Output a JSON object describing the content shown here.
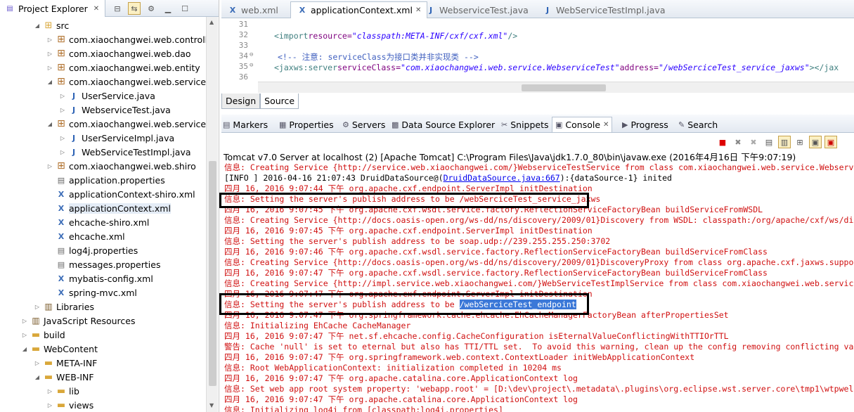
{
  "explorer": {
    "title": "Project Explorer",
    "items": [
      {
        "label": "src",
        "kind": "folder-src",
        "twisty": "open"
      },
      {
        "label": "com.xiaochangwei.web.controller",
        "kind": "pkg",
        "twisty": "closed"
      },
      {
        "label": "com.xiaochangwei.web.dao",
        "kind": "pkg",
        "twisty": "closed"
      },
      {
        "label": "com.xiaochangwei.web.entity",
        "kind": "pkg",
        "twisty": "closed"
      },
      {
        "label": "com.xiaochangwei.web.service",
        "kind": "pkg",
        "twisty": "open"
      },
      {
        "label": "UserService.java",
        "kind": "java",
        "twisty": "closed"
      },
      {
        "label": "WebserviceTest.java",
        "kind": "java",
        "twisty": "closed"
      },
      {
        "label": "com.xiaochangwei.web.service.im",
        "kind": "pkg",
        "twisty": "open"
      },
      {
        "label": "UserServiceImpl.java",
        "kind": "java",
        "twisty": "closed"
      },
      {
        "label": "WebServiceTestImpl.java",
        "kind": "java",
        "twisty": "closed"
      },
      {
        "label": "com.xiaochangwei.web.shiro",
        "kind": "pkg",
        "twisty": "closed"
      },
      {
        "label": "application.properties",
        "kind": "prop",
        "twisty": ""
      },
      {
        "label": "applicationContext-shiro.xml",
        "kind": "xml",
        "twisty": ""
      },
      {
        "label": "applicationContext.xml",
        "kind": "xml",
        "twisty": "",
        "selected": true
      },
      {
        "label": "ehcache-shiro.xml",
        "kind": "xml",
        "twisty": ""
      },
      {
        "label": "ehcache.xml",
        "kind": "xml",
        "twisty": ""
      },
      {
        "label": "log4j.properties",
        "kind": "prop",
        "twisty": ""
      },
      {
        "label": "messages.properties",
        "kind": "prop",
        "twisty": ""
      },
      {
        "label": "mybatis-config.xml",
        "kind": "xml",
        "twisty": ""
      },
      {
        "label": "spring-mvc.xml",
        "kind": "xml",
        "twisty": ""
      },
      {
        "label": "Libraries",
        "kind": "lib",
        "twisty": "closed"
      },
      {
        "label": "JavaScript Resources",
        "kind": "lib",
        "twisty": "closed"
      },
      {
        "label": "build",
        "kind": "folder",
        "twisty": "closed"
      },
      {
        "label": "WebContent",
        "kind": "folder",
        "twisty": "open"
      },
      {
        "label": "META-INF",
        "kind": "folder",
        "twisty": "closed"
      },
      {
        "label": "WEB-INF",
        "kind": "folder",
        "twisty": "open"
      },
      {
        "label": "lib",
        "kind": "folder",
        "twisty": "closed"
      },
      {
        "label": "views",
        "kind": "folder",
        "twisty": "closed"
      }
    ]
  },
  "editor": {
    "tabs": [
      {
        "label": "web.xml",
        "active": false
      },
      {
        "label": "applicationContext.xml",
        "active": true
      },
      {
        "label": "WebserviceTest.java",
        "active": false
      },
      {
        "label": "WebServiceTestImpl.java",
        "active": false
      }
    ],
    "lines": [
      {
        "num": "31",
        "parts": []
      },
      {
        "num": "32",
        "parts": [
          [
            "tg",
            "<import "
          ],
          [
            "at",
            "resource="
          ],
          [
            "av",
            "\"classpath:META-INF/cxf/cxf.xml\""
          ],
          [
            "tg",
            " />"
          ]
        ]
      },
      {
        "num": "33",
        "parts": []
      },
      {
        "num": "34",
        "marker": "⊖",
        "parts": [
          [
            "cm",
            "<!-- 注意: serviceClass为接口类并非实现类 -->"
          ]
        ]
      },
      {
        "num": "35",
        "marker": "⊖",
        "parts": [
          [
            "tg",
            "<jaxws:server "
          ],
          [
            "at",
            "serviceClass="
          ],
          [
            "av",
            "\"com.xiaochangwei.web.service.WebserviceTest\""
          ],
          [
            "at",
            " address="
          ],
          [
            "av",
            "\"/webSerciceTest_service_jaxws\""
          ],
          [
            "tg",
            "></jax"
          ]
        ]
      },
      {
        "num": "36",
        "parts": []
      }
    ],
    "design_tab": "Design",
    "source_tab": "Source"
  },
  "console": {
    "tabs": [
      {
        "label": "Markers",
        "icon": "▤"
      },
      {
        "label": "Properties",
        "icon": "▦"
      },
      {
        "label": "Servers",
        "icon": "⚙"
      },
      {
        "label": "Data Source Explorer",
        "icon": "▩"
      },
      {
        "label": "Snippets",
        "icon": "✂"
      },
      {
        "label": "Console",
        "icon": "▣",
        "active": true
      },
      {
        "label": "Progress",
        "icon": "▶"
      },
      {
        "label": "Search",
        "icon": "✎"
      }
    ],
    "title": "Tomcat v7.0 Server at localhost (2) [Apache Tomcat] C:\\Program Files\\Java\\jdk1.7.0_80\\bin\\javaw.exe (2016年4月16日 下午9:07:19)",
    "lines": [
      {
        "t": "信息: Creating Service {http://service.web.xiaochangwei.com/}WebserviceTestService from class com.xiaochangwei.web.service.Webserv"
      },
      {
        "t": "[INFO ] 2016-04-16 21:07:43 DruidDataSource@(",
        "link": "DruidDataSource.java:667",
        "after": "):{dataSource-1} inited",
        "info": true
      },
      {
        "t": "四月 16, 2016 9:07:44 下午 org.apache.cxf.endpoint.ServerImpl initDestination"
      },
      {
        "t": "信息: Setting the server's publish address to be /webSerciceTest_service_jaxws"
      },
      {
        "t": "四月 16, 2016 9:07:45 下午 org.apache.cxf.wsdl.service.factory.ReflectionServiceFactoryBean buildServiceFromWSDL"
      },
      {
        "t": "信息: Creating Service {http://docs.oasis-open.org/ws-dd/ns/discovery/2009/01}Discovery from WSDL: classpath:/org/apache/cxf/ws/di"
      },
      {
        "t": "四月 16, 2016 9:07:45 下午 org.apache.cxf.endpoint.ServerImpl initDestination"
      },
      {
        "t": "信息: Setting the server's publish address to be soap.udp://239.255.255.250:3702"
      },
      {
        "t": "四月 16, 2016 9:07:46 下午 org.apache.cxf.wsdl.service.factory.ReflectionServiceFactoryBean buildServiceFromClass"
      },
      {
        "t": "信息: Creating Service {http://docs.oasis-open.org/ws-dd/ns/discovery/2009/01}DiscoveryProxy from class org.apache.cxf.jaxws.suppo"
      },
      {
        "t": "四月 16, 2016 9:07:47 下午 org.apache.cxf.wsdl.service.factory.ReflectionServiceFactoryBean buildServiceFromClass"
      },
      {
        "t": "信息: Creating Service {http://impl.service.web.xiaochangwei.com/}WebServiceTestImplService from class com.xiaochangwei.web.servic"
      },
      {
        "t": "四月 16, 2016 9:07:47 下午 org.apache.cxf.endpoint.ServerImpl initDestination"
      },
      {
        "t": "信息: Setting the server's publish address to be ",
        "hl": "/webSerciceTest_endpoint"
      },
      {
        "t": "四月 16, 2016 9:07:47 下午 org.springframework.cache.ehcache.EhCacheManagerFactoryBean afterPropertiesSet"
      },
      {
        "t": "信息: Initializing EhCache CacheManager"
      },
      {
        "t": "四月 16, 2016 9:07:47 下午 net.sf.ehcache.config.CacheConfiguration isEternalValueConflictingWithTTIOrTTL"
      },
      {
        "t": "警告: Cache 'null' is set to eternal but also has TTI/TTL set.  To avoid this warning, clean up the config removing conflicting va"
      },
      {
        "t": "四月 16, 2016 9:07:47 下午 org.springframework.web.context.ContextLoader initWebApplicationContext"
      },
      {
        "t": "信息: Root WebApplicationContext: initialization completed in 10204 ms"
      },
      {
        "t": "四月 16, 2016 9:07:47 下午 org.apache.catalina.core.ApplicationContext log"
      },
      {
        "t": "信息: Set web app root system property: 'webapp.root' = [D:\\dev\\project\\.metadata\\.plugins\\org.eclipse.wst.server.core\\tmp1\\wtpwel"
      },
      {
        "t": "四月 16, 2016 9:07:47 下午 org.apache.catalina.core.ApplicationContext log"
      },
      {
        "t": "信息: Initializing log4j from [classpath:log4j.properties]"
      }
    ]
  },
  "colors": {
    "error_text": "#d01010",
    "highlight": "#3b78d8",
    "box": "#000000"
  }
}
